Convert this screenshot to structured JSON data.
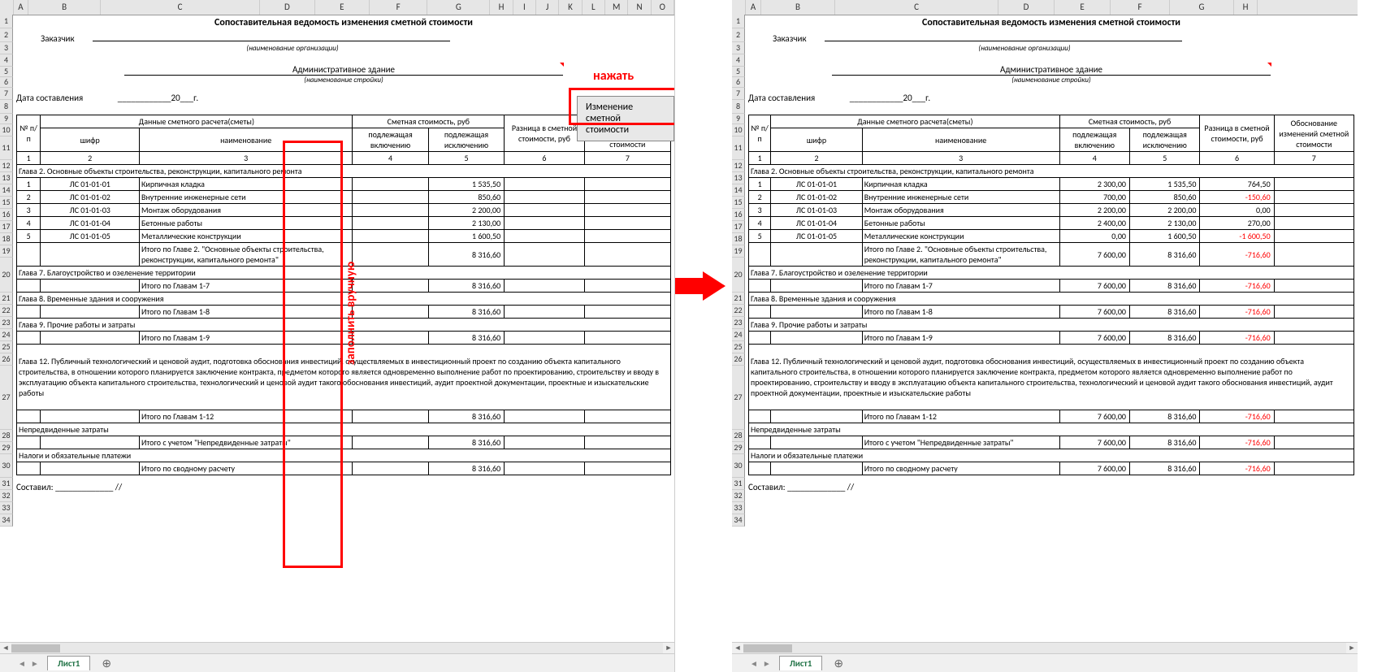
{
  "ui": {
    "sheet_tab": "Лист1",
    "press_label": "нажать",
    "button": "Изменение сметной стоимости",
    "fill_label": "заполнить вручную"
  },
  "cols_left": [
    "A",
    "B",
    "C",
    "D",
    "E",
    "F",
    "G",
    "H",
    "I",
    "J",
    "K",
    "L",
    "M",
    "N",
    "O"
  ],
  "cols_right": [
    "A",
    "B",
    "C",
    "D",
    "E",
    "F",
    "G",
    "H"
  ],
  "rows": [
    "1",
    "2",
    "3",
    "4",
    "5",
    "6",
    "7",
    "8",
    "9",
    "10",
    "11",
    "12",
    "13",
    "14",
    "15",
    "16",
    "17",
    "18",
    "19",
    "20",
    "21",
    "22",
    "23",
    "24",
    "25",
    "26",
    "27",
    "28",
    "29",
    "30",
    "31",
    "32",
    "33",
    "34"
  ],
  "doc": {
    "title": "Сопоставительная ведомость изменения сметной стоимости",
    "customer": "Заказчик",
    "org_hint": "(наименование организации)",
    "building": "Административное здание",
    "build_hint": "(наименование стройки)",
    "date_label": "Дата составления",
    "date_val": "____________20___г.",
    "footer": "Составил: _____________ //"
  },
  "head": {
    "npp": "№ п/п",
    "data": "Данные сметного расчета(сметы)",
    "shifr": "шифр",
    "name": "наименование",
    "cost": "Сметная стоимость, руб",
    "incl": "подлежащая включению",
    "excl": "подлежащая исключению",
    "diff": "Разница в сметной стоимости, руб",
    "reason": "Обоснование изменений сметной стоимости",
    "n1": "1",
    "n2": "2",
    "n3": "3",
    "n4": "4",
    "n5": "5",
    "n6": "6",
    "n7": "7"
  },
  "sections": {
    "g2": "Глава 2. Основные объекты строительства, реконструкции, капитального ремонта",
    "g2_total": "Итого по Главе 2. \"Основные объекты строительства, реконструкции, капитального ремонта\"",
    "g7": "Глава 7. Благоустройство и озеленение территории",
    "g7_total": "Итого по Главам 1-7",
    "g8": "Глава 8. Временные здания и сооружения",
    "g8_total": "Итого по Главам 1-8",
    "g9": "Глава 9. Прочие работы и затраты",
    "g9_total": "Итого по Главам 1-9",
    "g12": "Глава 12. Публичный технологический и ценовой аудит, подготовка обоснования инвестиций, осуществляемых в инвестиционный проект по созданию объекта капитального строительства, в отношении которого планируется заключение контракта, предметом которого является одновременно выполнение работ по проектированию, строительству и вводу в эксплуатацию объекта капитального строительства, технологический и ценовой аудит такого обоснования инвестиций, аудит проектной документации, проектные и изыскательские работы",
    "g12_total": "Итого по Главам 1-12",
    "unexp": "Непредвиденные затраты",
    "unexp_total": "Итого с учетом \"Непредвиденные затраты\"",
    "tax": "Налоги и обязательные платежи",
    "final": "Итого по сводному расчету"
  },
  "rows_items": [
    {
      "n": "1",
      "code": "ЛС 01-01-01",
      "name": "Кирпичная кладка",
      "excl": "1 535,50"
    },
    {
      "n": "2",
      "code": "ЛС 01-01-02",
      "name": "Внутренние инженерные сети",
      "excl": "850,60"
    },
    {
      "n": "3",
      "code": "ЛС 01-01-03",
      "name": "Монтаж оборудования",
      "excl": "2 200,00"
    },
    {
      "n": "4",
      "code": "ЛС 01-01-04",
      "name": "Бетонные работы",
      "excl": "2 130,00"
    },
    {
      "n": "5",
      "code": "ЛС 01-01-05",
      "name": "Металлические конструкции",
      "excl": "1 600,50"
    }
  ],
  "left_totals": {
    "g2": "8 316,60",
    "g7": "8 316,60",
    "g8": "8 316,60",
    "g9": "8 316,60",
    "g12": "8 316,60",
    "unexp": "8 316,60",
    "final": "8 316,60"
  },
  "rows_items_r": [
    {
      "n": "1",
      "code": "ЛС 01-01-01",
      "name": "Кирпичная кладка",
      "incl": "2 300,00",
      "excl": "1 535,50",
      "diff": "764,50",
      "neg": false
    },
    {
      "n": "2",
      "code": "ЛС 01-01-02",
      "name": "Внутренние инженерные сети",
      "incl": "700,00",
      "excl": "850,60",
      "diff": "-150,60",
      "neg": true
    },
    {
      "n": "3",
      "code": "ЛС 01-01-03",
      "name": "Монтаж оборудования",
      "incl": "2 200,00",
      "excl": "2 200,00",
      "diff": "0,00",
      "neg": false
    },
    {
      "n": "4",
      "code": "ЛС 01-01-04",
      "name": "Бетонные работы",
      "incl": "2 400,00",
      "excl": "2 130,00",
      "diff": "270,00",
      "neg": false
    },
    {
      "n": "5",
      "code": "ЛС 01-01-05",
      "name": "Металлические конструкции",
      "incl": "0,00",
      "excl": "1 600,50",
      "diff": "-1 600,50",
      "neg": true
    }
  ],
  "right_totals": {
    "g2": {
      "incl": "7 600,00",
      "excl": "8 316,60",
      "diff": "-716,60"
    },
    "g7": {
      "incl": "7 600,00",
      "excl": "8 316,60",
      "diff": "-716,60"
    },
    "g8": {
      "incl": "7 600,00",
      "excl": "8 316,60",
      "diff": "-716,60"
    },
    "g9": {
      "incl": "7 600,00",
      "excl": "8 316,60",
      "diff": "-716,60"
    },
    "g12": {
      "incl": "7 600,00",
      "excl": "8 316,60",
      "diff": "-716,60"
    },
    "unexp": {
      "incl": "7 600,00",
      "excl": "8 316,60",
      "diff": "-716,60"
    },
    "final": {
      "incl": "7 600,00",
      "excl": "8 316,60",
      "diff": "-716,60"
    }
  }
}
